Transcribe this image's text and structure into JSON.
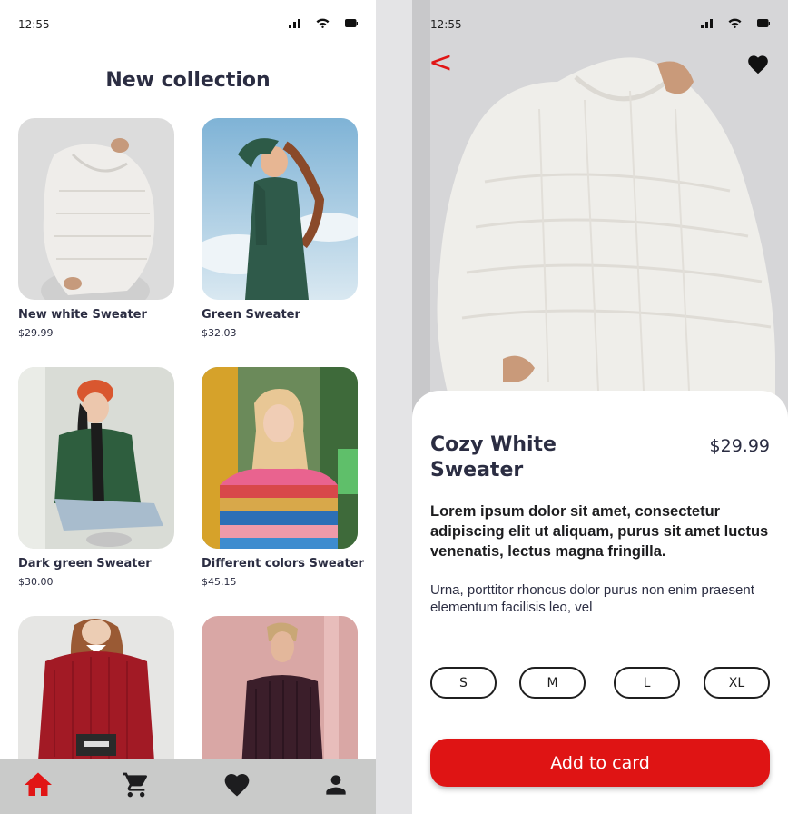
{
  "list_screen": {
    "status": {
      "time": "12:55"
    },
    "title": "New collection",
    "products": [
      {
        "name": "New white Sweater",
        "price": "$29.99"
      },
      {
        "name": "Green Sweater",
        "price": "$32.03"
      },
      {
        "name": "Dark green Sweater",
        "price": "$30.00"
      },
      {
        "name": "Different colors Sweater",
        "price": "$45.15"
      },
      {
        "name": "",
        "price": ""
      },
      {
        "name": "",
        "price": ""
      }
    ],
    "nav": {
      "items": [
        "home-icon",
        "cart-icon",
        "heart-icon",
        "user-icon"
      ],
      "active": "home-icon",
      "active_color": "#e11515",
      "inactive_color": "#1d1d1f"
    }
  },
  "detail_screen": {
    "status": {
      "time": "12:55"
    },
    "back_label": "<",
    "product": {
      "title": "Cozy White Sweater",
      "price": "$29.99",
      "lead": "Lorem ipsum dolor sit amet, consectetur adipiscing elit ut aliquam, purus sit amet luctus venenatis, lectus magna fringilla.",
      "description": "Urna, porttitor rhoncus dolor purus non enim praesent elementum facilisis leo, vel"
    },
    "sizes": [
      "S",
      "M",
      "L",
      "XL"
    ],
    "cta_label": "Add to card"
  },
  "colors": {
    "accent": "#df1414",
    "text_dark": "#2b2d42",
    "nav_background": "#c9cac9"
  }
}
